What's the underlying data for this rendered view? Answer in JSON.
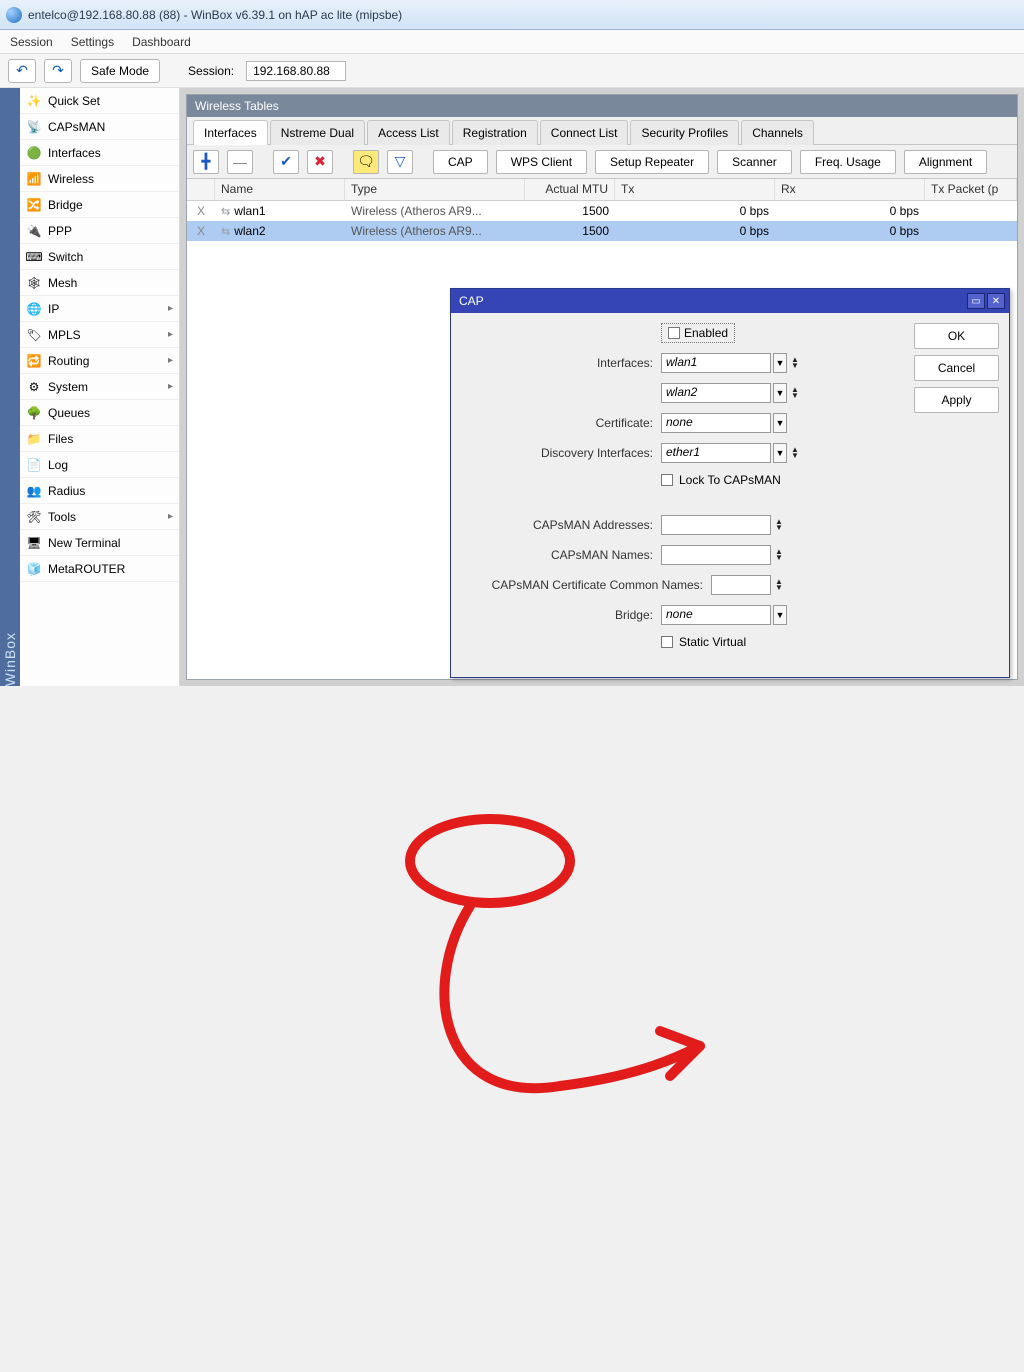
{
  "titlebar": {
    "text": "entelco@192.168.80.88 (88) - WinBox v6.39.1 on hAP ac lite (mipsbe)"
  },
  "menubar": {
    "session": "Session",
    "settings": "Settings",
    "dashboard": "Dashboard"
  },
  "toolbar": {
    "safemode": "Safe Mode",
    "session_label": "Session:",
    "session_value": "192.168.80.88"
  },
  "sidebrand": "WinBox",
  "nav": {
    "items": [
      {
        "label": "Quick Set",
        "icon": "✨",
        "sub": false
      },
      {
        "label": "CAPsMAN",
        "icon": "📡",
        "sub": false
      },
      {
        "label": "Interfaces",
        "icon": "🟢",
        "sub": false
      },
      {
        "label": "Wireless",
        "icon": "📶",
        "sub": false
      },
      {
        "label": "Bridge",
        "icon": "🔀",
        "sub": false
      },
      {
        "label": "PPP",
        "icon": "🔌",
        "sub": false
      },
      {
        "label": "Switch",
        "icon": "⌨",
        "sub": false
      },
      {
        "label": "Mesh",
        "icon": "🕸",
        "sub": false
      },
      {
        "label": "IP",
        "icon": "🌐",
        "sub": true
      },
      {
        "label": "MPLS",
        "icon": "🏷",
        "sub": true
      },
      {
        "label": "Routing",
        "icon": "🔁",
        "sub": true
      },
      {
        "label": "System",
        "icon": "⚙",
        "sub": true
      },
      {
        "label": "Queues",
        "icon": "🌳",
        "sub": false
      },
      {
        "label": "Files",
        "icon": "📁",
        "sub": false
      },
      {
        "label": "Log",
        "icon": "📄",
        "sub": false
      },
      {
        "label": "Radius",
        "icon": "👥",
        "sub": false
      },
      {
        "label": "Tools",
        "icon": "🛠",
        "sub": true
      },
      {
        "label": "New Terminal",
        "icon": "🖥",
        "sub": false
      },
      {
        "label": "MetaROUTER",
        "icon": "🧊",
        "sub": false
      }
    ]
  },
  "panel": {
    "title": "Wireless Tables",
    "tabs": [
      "Interfaces",
      "Nstreme Dual",
      "Access List",
      "Registration",
      "Connect List",
      "Security Profiles",
      "Channels"
    ],
    "active_tab": 0,
    "buttons": {
      "add": "╋",
      "remove": "—",
      "enable": "✔",
      "disable": "✖",
      "comment": "🗨",
      "filter": "▽",
      "cap": "CAP",
      "wps": "WPS Client",
      "repeater": "Setup Repeater",
      "scanner": "Scanner",
      "freq": "Freq. Usage",
      "align": "Alignment"
    },
    "columns": [
      "",
      "Name",
      "Type",
      "Actual MTU",
      "Tx",
      "Rx",
      "Tx Packet (p"
    ],
    "rows": [
      {
        "mark": "X",
        "name": "wlan1",
        "type": "Wireless (Atheros AR9...",
        "mtu": "1500",
        "tx": "0 bps",
        "rx": "0 bps"
      },
      {
        "mark": "X",
        "name": "wlan2",
        "type": "Wireless (Atheros AR9...",
        "mtu": "1500",
        "tx": "0 bps",
        "rx": "0 bps"
      }
    ]
  },
  "dialog": {
    "title": "CAP",
    "enabled_label": "Enabled",
    "interfaces_label": "Interfaces:",
    "interfaces": [
      "wlan1",
      "wlan2"
    ],
    "certificate_label": "Certificate:",
    "certificate_value": "none",
    "discovery_label": "Discovery Interfaces:",
    "discovery_value": "ether1",
    "lock_label": "Lock To CAPsMAN",
    "cm_addr_label": "CAPsMAN Addresses:",
    "cm_names_label": "CAPsMAN Names:",
    "cm_cert_label": "CAPsMAN Certificate Common Names:",
    "bridge_label": "Bridge:",
    "bridge_value": "none",
    "static_label": "Static Virtual",
    "ok": "OK",
    "cancel": "Cancel",
    "apply": "Apply"
  }
}
